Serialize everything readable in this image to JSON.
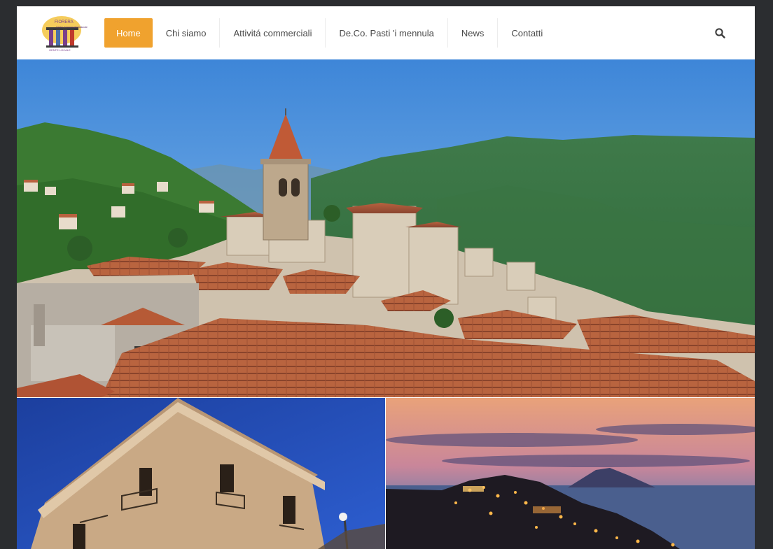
{
  "site": {
    "logo_icon": "fiorera-logo-icon",
    "logo_text_top": "FIORERA",
    "logo_text_mid": "Centro Commerciale Naturale",
    "logo_text_bottom": "GENTE LOCALE"
  },
  "nav": {
    "items": [
      {
        "label": "Home",
        "active": true
      },
      {
        "label": "Chi siamo"
      },
      {
        "label": "Attivitá commerciali"
      },
      {
        "label": "De.Co. Pasti 'i mennula"
      },
      {
        "label": "News"
      },
      {
        "label": "Contatti"
      }
    ],
    "search_icon": "search-icon"
  },
  "colors": {
    "accent": "#f0a22e",
    "page_bg": "#2b2d30",
    "header_bg": "#ffffff",
    "nav_text": "#4a4a4a"
  },
  "images": {
    "hero": "hilltop-village-bell-tower-photo",
    "tile_left": "stone-palazzo-blue-sky-photo",
    "tile_right": "village-lights-at-dusk-photo"
  }
}
